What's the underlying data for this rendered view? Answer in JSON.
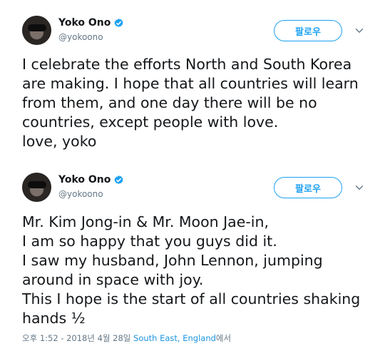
{
  "tweets": [
    {
      "display_name": "Yoko Ono",
      "handle": "@yokoono",
      "follow_label": "팔로우",
      "text": "I celebrate the efforts North and South Korea\nare making. I hope that all countries will learn\nfrom them, and one day there will be no\ncountries, except people with love.\nlove, yoko"
    },
    {
      "display_name": "Yoko Ono",
      "handle": "@yokoono",
      "follow_label": "팔로우",
      "text": "Mr. Kim Jong-in & Mr. Moon Jae-in,\nI am so happy that you guys did it.\nI saw my husband, John Lennon, jumping\naround in space with joy.\nThis I hope is the start of all countries shaking\nhands ½",
      "meta": {
        "time": "오후 1:52 - 2018년 4월 28일",
        "location": "South East, England",
        "location_suffix": "에서"
      }
    }
  ],
  "icons": {
    "verified": "verified-badge-icon",
    "chevron": "chevron-down-icon"
  },
  "colors": {
    "accent": "#1da1f2",
    "secondary_text": "#657786",
    "location_link": "#1b95e0"
  }
}
